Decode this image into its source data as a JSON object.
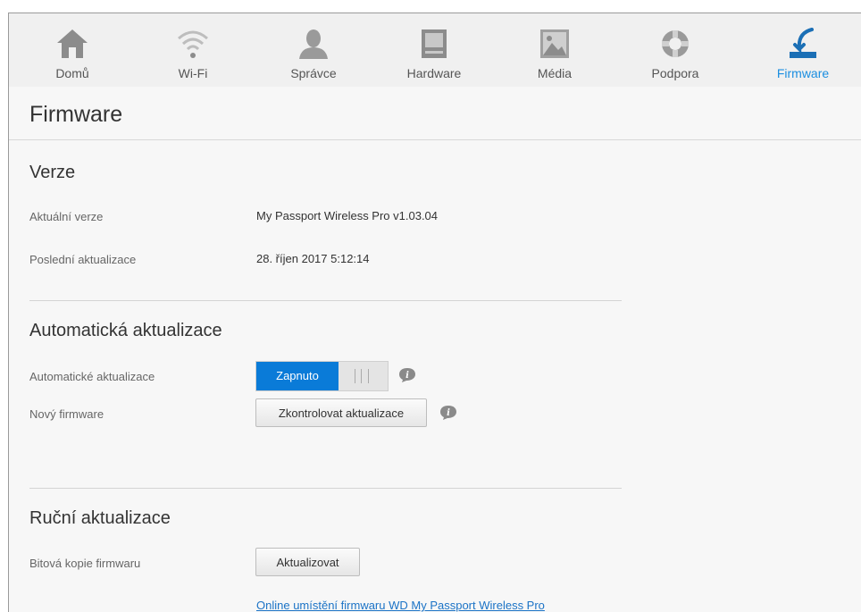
{
  "nav": {
    "items": [
      {
        "label": "Domů",
        "icon": "home-icon"
      },
      {
        "label": "Wi-Fi",
        "icon": "wifi-icon"
      },
      {
        "label": "Správce",
        "icon": "user-icon"
      },
      {
        "label": "Hardware",
        "icon": "hardware-icon"
      },
      {
        "label": "Média",
        "icon": "media-icon"
      },
      {
        "label": "Podpora",
        "icon": "support-icon"
      },
      {
        "label": "Firmware",
        "icon": "firmware-icon"
      }
    ],
    "active": "Firmware",
    "colors": {
      "icon": "#8c8c8c",
      "active": "#1b8ee0"
    }
  },
  "page": {
    "title": "Firmware"
  },
  "version": {
    "title": "Verze",
    "current_label": "Aktuální verze",
    "current_value": "My Passport Wireless Pro v1.03.04",
    "last_update_label": "Poslední aktualizace",
    "last_update_value": "28. říjen 2017 5:12:14"
  },
  "auto_update": {
    "title": "Automatická aktualizace",
    "toggle_label": "Automatické aktualizace",
    "toggle_state": "Zapnuto",
    "new_fw_label": "Nový firmware",
    "check_button": "Zkontrolovat aktualizace"
  },
  "manual_update": {
    "title": "Ruční aktualizace",
    "image_label": "Bitová kopie firmwaru",
    "update_button": "Aktualizovat",
    "online_link": "Online umístění firmwaru WD My Passport Wireless Pro"
  },
  "colors": {
    "accent": "#0a7bd8",
    "link": "#1b73c6"
  }
}
